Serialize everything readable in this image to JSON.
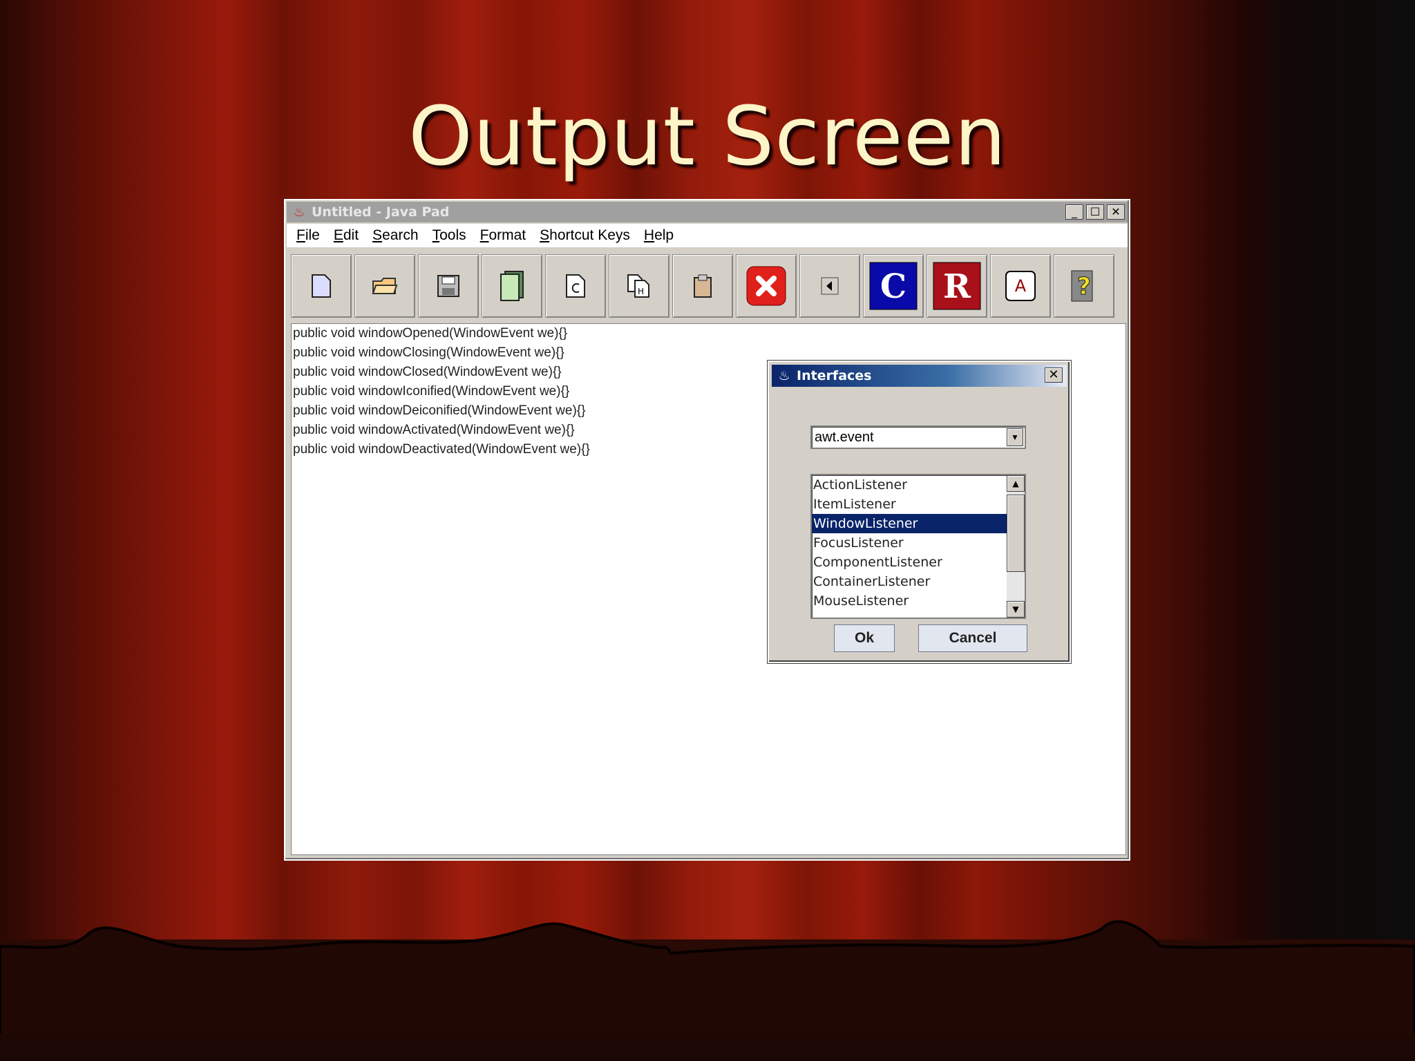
{
  "slide": {
    "title": "Output Screen"
  },
  "window": {
    "title": "Untitled - Java Pad",
    "controls": {
      "minimize": "_",
      "maximize": "☐",
      "close": "✕"
    },
    "menu": [
      "File",
      "Edit",
      "Search",
      "Tools",
      "Format",
      "Shortcut Keys",
      "Help"
    ],
    "toolbar": [
      {
        "icon": "new-file-icon"
      },
      {
        "icon": "open-folder-icon"
      },
      {
        "icon": "save-icon"
      },
      {
        "icon": "copy-pages-icon"
      },
      {
        "icon": "page-refresh-icon"
      },
      {
        "icon": "find-replace-icon"
      },
      {
        "icon": "clipboard-icon"
      },
      {
        "icon": "close-x-icon",
        "color": "#e0201a"
      },
      {
        "icon": "back-arrow-icon"
      },
      {
        "icon": "compile-icon",
        "letter": "C",
        "color": "#0a0aa8"
      },
      {
        "icon": "run-icon",
        "letter": "R",
        "color": "#a8101a"
      },
      {
        "icon": "font-icon",
        "letter": "A"
      },
      {
        "icon": "help-icon"
      }
    ],
    "editor_lines": [
      "public void windowOpened(WindowEvent we){}",
      "public void windowClosing(WindowEvent we){}",
      "public void windowClosed(WindowEvent we){}",
      "public void windowIconified(WindowEvent we){}",
      "public void windowDeiconified(WindowEvent we){}",
      "public void windowActivated(WindowEvent we){}",
      "public void windowDeactivated(WindowEvent we){}"
    ]
  },
  "dialog": {
    "title": "Interfaces",
    "close": "✕",
    "package_combo": "awt.event",
    "interfaces": [
      "ActionListener",
      "ItemListener",
      "WindowListener",
      "FocusListener",
      "ComponentListener",
      "ContainerListener",
      "MouseListener"
    ],
    "selected": "WindowListener",
    "ok_label": "Ok",
    "cancel_label": "Cancel"
  },
  "colors": {
    "title_text": "#fdf5c8",
    "selection": "#0a246a",
    "curtain": "#9a1a0c"
  }
}
